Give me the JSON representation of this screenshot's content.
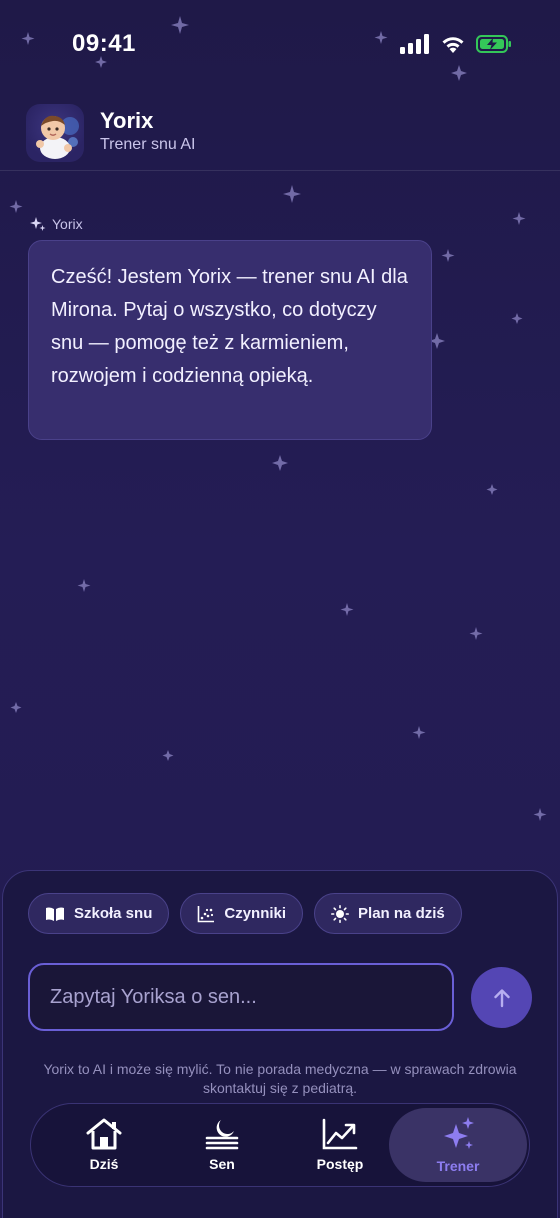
{
  "status_bar": {
    "time": "09:41",
    "icons": [
      "cellular-signal-icon",
      "wifi-icon",
      "battery-charging-icon"
    ]
  },
  "header": {
    "name": "Yorix",
    "subtitle": "Trener snu AI",
    "avatar_icon": "baby-avatar-icon"
  },
  "chat": {
    "messages": [
      {
        "author": "Yorix",
        "author_icon": "sparkle-icon",
        "text": "Cześć! Jestem Yorix — trener snu AI dla Mirona. Pytaj o wszystko, co dotyczy snu — pomogę też z karmieniem, rozwojem i codzienną opieką."
      }
    ]
  },
  "quick_actions": [
    {
      "label": "Szkoła snu",
      "icon": "open-book-icon"
    },
    {
      "label": "Czynniki",
      "icon": "scatter-chart-icon"
    },
    {
      "label": "Plan na dziś",
      "icon": "sun-icon"
    }
  ],
  "composer": {
    "placeholder": "Zapytaj Yoriksa o sen...",
    "send_icon": "arrow-up-icon"
  },
  "disclaimer": "Yorix to AI i może się mylić. To nie porada medyczna — w sprawach zdrowia skontaktuj się z pediatrą.",
  "tabs": [
    {
      "label": "Dziś",
      "icon": "home-icon",
      "active": false
    },
    {
      "label": "Sen",
      "icon": "moon-waves-icon",
      "active": false
    },
    {
      "label": "Postęp",
      "icon": "trend-chart-icon",
      "active": false
    },
    {
      "label": "Trener",
      "icon": "sparkles-icon",
      "active": true
    }
  ],
  "colors": {
    "background": "#211b4e",
    "bubble": "#372e6e",
    "accent": "#6a5fd6",
    "active_tab_label": "#8d7df0"
  }
}
